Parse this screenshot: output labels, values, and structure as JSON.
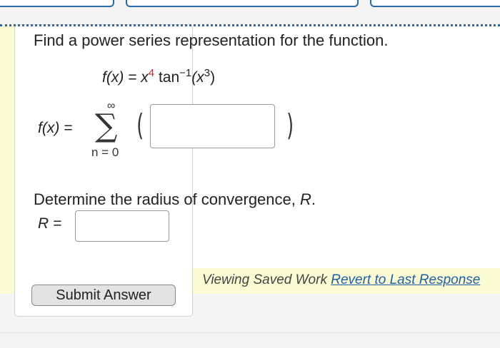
{
  "question": {
    "prompt": "Find a power series representation for the function.",
    "function_lhs": "f(x) =",
    "function_rhs_x": "x",
    "function_rhs_exp": "4",
    "function_rhs_tan": " tan",
    "function_rhs_inv": "−1",
    "function_rhs_arg_open": "(x",
    "function_rhs_arg_exp": "3",
    "function_rhs_arg_close": ")",
    "series_lhs": "f(x) =",
    "sigma_symbol": "∑",
    "upper_limit": "∞",
    "lower_limit": "n = 0",
    "paren_open": "(",
    "paren_close": ")",
    "series_term_value": "",
    "radius_prompt_prefix": "Determine the radius of convergence, ",
    "radius_var": "R",
    "radius_prompt_suffix": ".",
    "radius_lhs": "R =",
    "radius_value": ""
  },
  "actions": {
    "submit_label": "Submit Answer",
    "saved_text": "Viewing Saved Work ",
    "revert_link": "Revert to Last Response"
  },
  "colors": {
    "accent": "#2a6aa8",
    "highlight": "#fcfcd4",
    "exponent_red": "#dd2222"
  }
}
